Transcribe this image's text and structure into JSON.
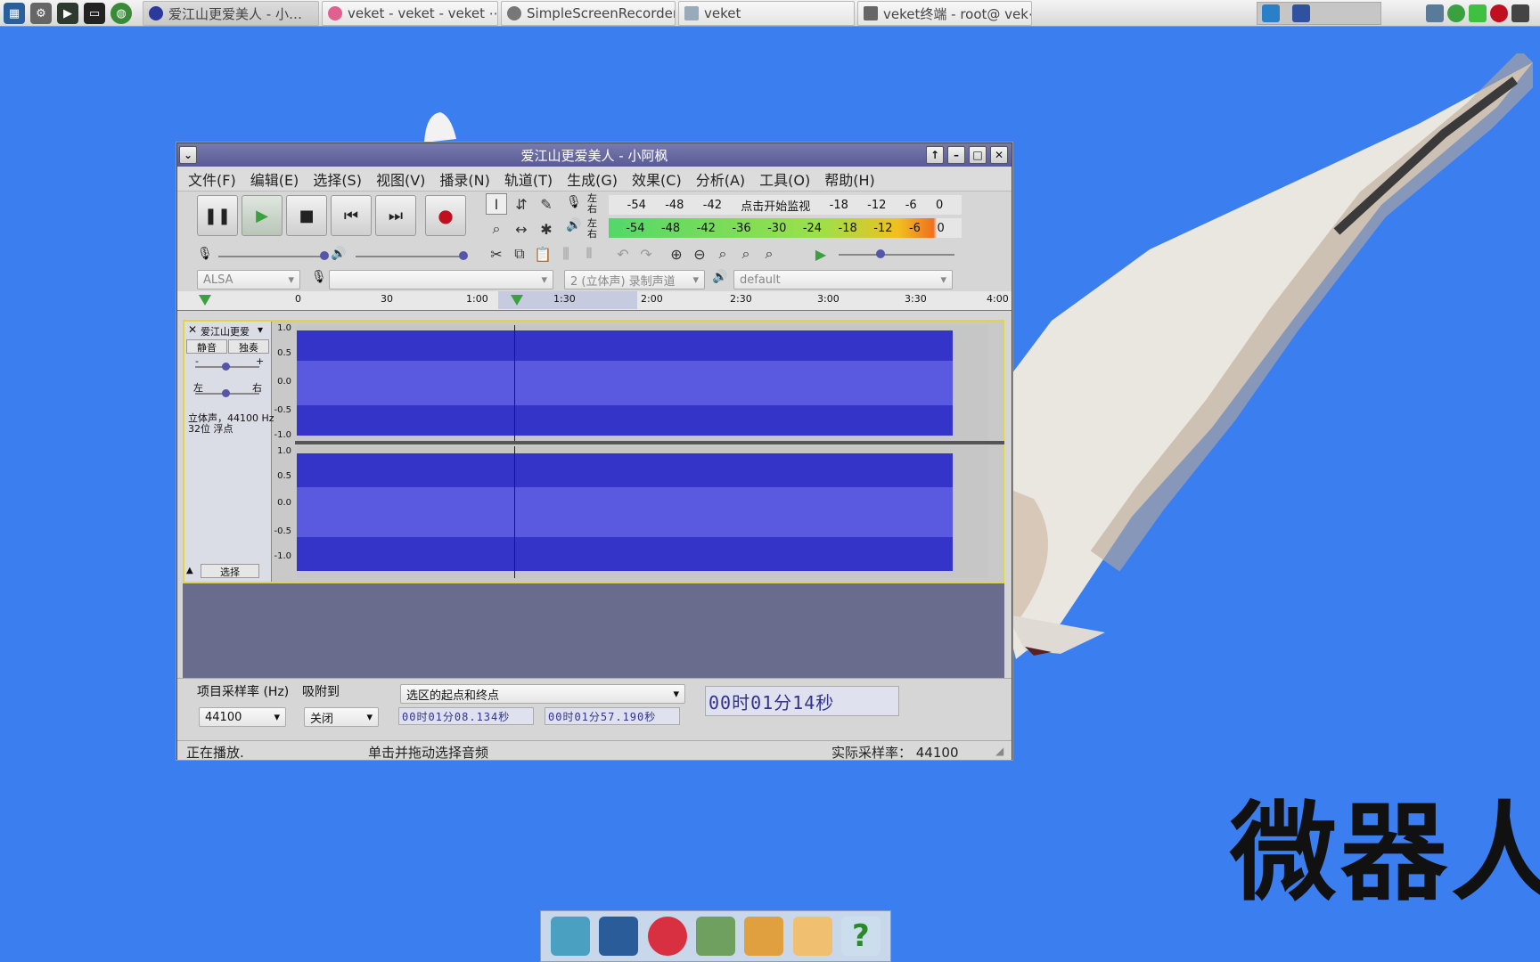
{
  "taskbar": {
    "tasks": [
      {
        "label": "爱江山更爱美人 - 小…",
        "active": true,
        "icon": "audacity-icon"
      },
      {
        "label": "veket - veket - veket ⋯",
        "active": false,
        "icon": "browser-icon"
      },
      {
        "label": "SimpleScreenRecorder",
        "active": false,
        "icon": "recorder-icon"
      },
      {
        "label": "veket",
        "active": false,
        "icon": "folder-icon"
      },
      {
        "label": "veket终端 - root@ vek⋯",
        "active": false,
        "icon": "terminal-icon"
      }
    ]
  },
  "desktop": {
    "watermark": "微器人"
  },
  "window": {
    "title": "爱江山更爱美人 - 小阿枫",
    "menu": [
      "文件(F)",
      "编辑(E)",
      "选择(S)",
      "视图(V)",
      "播录(N)",
      "轨道(T)",
      "生成(G)",
      "效果(C)",
      "分析(A)",
      "工具(O)",
      "帮助(H)"
    ],
    "meters": {
      "rec_channels": "左\n右",
      "rec_scale": [
        "-54",
        "-48",
        "-42",
        "点击开始监视",
        "-18",
        "-12",
        "-6",
        "0"
      ],
      "play_scale": [
        "-54",
        "-48",
        "-42",
        "-36",
        "-30",
        "-24",
        "-18",
        "-12",
        "-6",
        "0"
      ]
    },
    "devices": {
      "host": "ALSA",
      "rec_device": "",
      "channels": "2 (立体声) 录制声道",
      "play_device": "default"
    },
    "ruler": [
      "0",
      "30",
      "1:00",
      "1:30",
      "2:00",
      "2:30",
      "3:00",
      "3:30",
      "4:00"
    ],
    "track": {
      "name": "爱江山更爱",
      "mute": "静音",
      "solo": "独奏",
      "gain_minus": "-",
      "gain_plus": "+",
      "pan_left": "左",
      "pan_right": "右",
      "info_line1": "立体声，44100 Hz",
      "info_line2": "32位 浮点",
      "select": "选择",
      "scale_top": [
        "1.0",
        "0.5",
        "0.0",
        "-0.5",
        "-1.0"
      ],
      "scale_bottom": [
        "1.0",
        "0.5",
        "0.0",
        "-0.5",
        "-1.0"
      ]
    },
    "selection_toolbar": {
      "rate_label": "项目采样率 (Hz)",
      "rate_value": "44100",
      "snap_label": "吸附到",
      "snap_value": "关闭",
      "mode": "选区的起点和终点",
      "start": "00时01分08.134秒",
      "end": "00时01分57.190秒",
      "position": "00时01分14秒"
    },
    "status": {
      "state": "正在播放.",
      "hint": "单击并拖动选择音频",
      "actual_rate": "实际采样率： 44100"
    }
  },
  "colors": {
    "desktop": "#3a7ef0",
    "title": "#6667a0",
    "wave": "#3434c8"
  }
}
